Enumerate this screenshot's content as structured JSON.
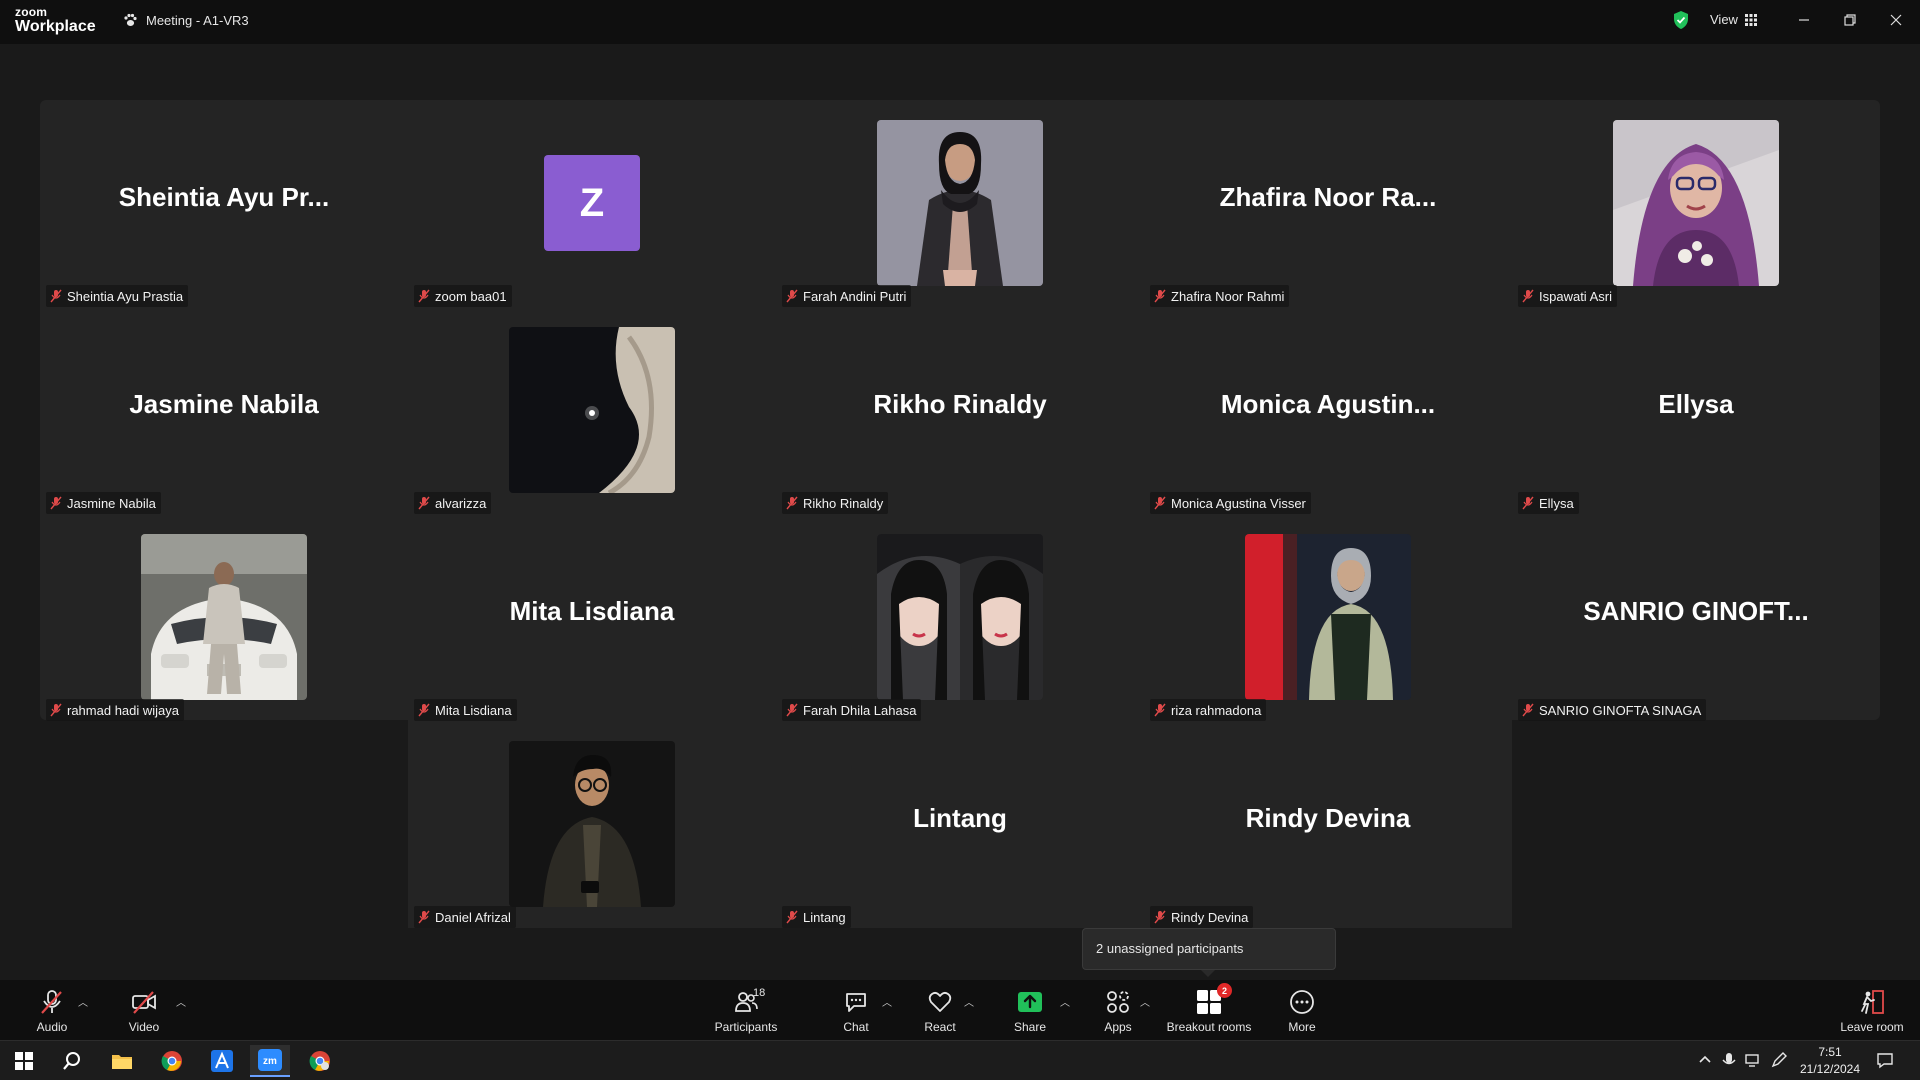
{
  "app": {
    "brand_top": "zoom",
    "brand_bottom": "Workplace",
    "meeting_title": "Meeting - A1-VR3",
    "view_label": "View"
  },
  "participants": [
    {
      "display": "Sheintia Ayu Pr...",
      "label": "Sheintia Ayu Prastia",
      "type": "name"
    },
    {
      "display": "Z",
      "label": "zoom baa01",
      "type": "letter"
    },
    {
      "display": "",
      "label": "Farah Andini Putri",
      "type": "photo",
      "photo": "woman-black-hijab"
    },
    {
      "display": "Zhafira Noor Ra...",
      "label": "Zhafira Noor Rahmi",
      "type": "name"
    },
    {
      "display": "",
      "label": "Ispawati Asri",
      "type": "photo",
      "photo": "woman-purple-hijab"
    },
    {
      "display": "Jasmine Nabila",
      "label": "Jasmine Nabila",
      "type": "name"
    },
    {
      "display": "",
      "label": "alvarizza",
      "type": "photo",
      "photo": "moon-dark"
    },
    {
      "display": "Rikho Rinaldy",
      "label": "Rikho Rinaldy",
      "type": "name"
    },
    {
      "display": "Monica Agustin...",
      "label": "Monica Agustina Visser",
      "type": "name"
    },
    {
      "display": "Ellysa",
      "label": "Ellysa",
      "type": "name"
    },
    {
      "display": "",
      "label": "rahmad hadi wijaya",
      "type": "photo",
      "photo": "man-white-car"
    },
    {
      "display": "Mita Lisdiana",
      "label": "Mita Lisdiana",
      "type": "name"
    },
    {
      "display": "",
      "label": "Farah Dhila Lahasa",
      "type": "photo",
      "photo": "two-girls-selfie"
    },
    {
      "display": "",
      "label": "riza rahmadona",
      "type": "photo",
      "photo": "woman-red-wall"
    },
    {
      "display": "SANRIO GINOFT...",
      "label": "SANRIO GINOFTA SINAGA",
      "type": "name"
    },
    {
      "display": "",
      "label": "Daniel Afrizal",
      "type": "photo",
      "photo": "man-glasses-dark"
    },
    {
      "display": "Lintang",
      "label": "Lintang",
      "type": "name"
    },
    {
      "display": "Rindy Devina",
      "label": "Rindy Devina",
      "type": "name"
    }
  ],
  "tooltip": {
    "text": "2 unassigned participants"
  },
  "toolbar": {
    "audio": "Audio",
    "video": "Video",
    "participants": "Participants",
    "participants_count": "18",
    "chat": "Chat",
    "react": "React",
    "share": "Share",
    "apps": "Apps",
    "breakout": "Breakout rooms",
    "breakout_badge": "2",
    "more": "More",
    "leave": "Leave room"
  },
  "taskbar": {
    "time": "7:51",
    "date": "21/12/2024"
  },
  "colors": {
    "accent_green": "#21c05a",
    "muted_red": "#e04a4a",
    "letter_avatar": "#8a5dd1",
    "badge": "#e02828"
  }
}
